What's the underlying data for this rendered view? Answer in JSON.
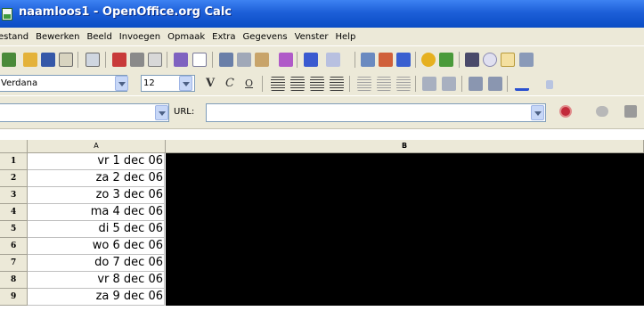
{
  "window": {
    "title": "naamloos1 - OpenOffice.org Calc"
  },
  "menu": [
    "estand",
    "Bewerken",
    "Beeld",
    "Invoegen",
    "Opmaak",
    "Extra",
    "Gegevens",
    "Venster",
    "Help"
  ],
  "toolbar": {
    "icons": [
      "new-icon",
      "open-icon",
      "save-icon",
      "email-icon",
      "edit-file-icon",
      "export-pdf-icon",
      "print-icon",
      "page-preview-icon",
      "spellcheck-icon",
      "autospellcheck-icon",
      "cut-icon",
      "copy-icon",
      "paste-icon",
      "format-paintbrush-icon",
      "undo-icon",
      "redo-icon",
      "hyperlink-icon",
      "sort-ascending-icon",
      "sort-descending-icon",
      "chart-icon",
      "draw-functions-icon",
      "find-replace-icon",
      "navigator-icon",
      "gallery-icon",
      "datasources-icon"
    ]
  },
  "format": {
    "font": "Verdana",
    "size": "12",
    "bold_glyph": "V",
    "italic_glyph": "C",
    "underline_glyph": "O"
  },
  "urlbar": {
    "label": "URL:"
  },
  "grid": {
    "columns": [
      "A",
      "B"
    ],
    "rows": [
      {
        "num": "1",
        "a": "vr 1 dec 06"
      },
      {
        "num": "2",
        "a": "za 2 dec 06"
      },
      {
        "num": "3",
        "a": "zo 3 dec 06"
      },
      {
        "num": "4",
        "a": "ma 4 dec 06"
      },
      {
        "num": "5",
        "a": "di 5 dec 06"
      },
      {
        "num": "6",
        "a": "wo 6 dec 06"
      },
      {
        "num": "7",
        "a": "do 7 dec 06"
      },
      {
        "num": "8",
        "a": "vr 8 dec 06"
      },
      {
        "num": "9",
        "a": "za 9 dec 06"
      }
    ]
  },
  "colors": {
    "titlebar": "#1d5fd8",
    "chrome": "#ece9d8",
    "selection": "#000000"
  }
}
